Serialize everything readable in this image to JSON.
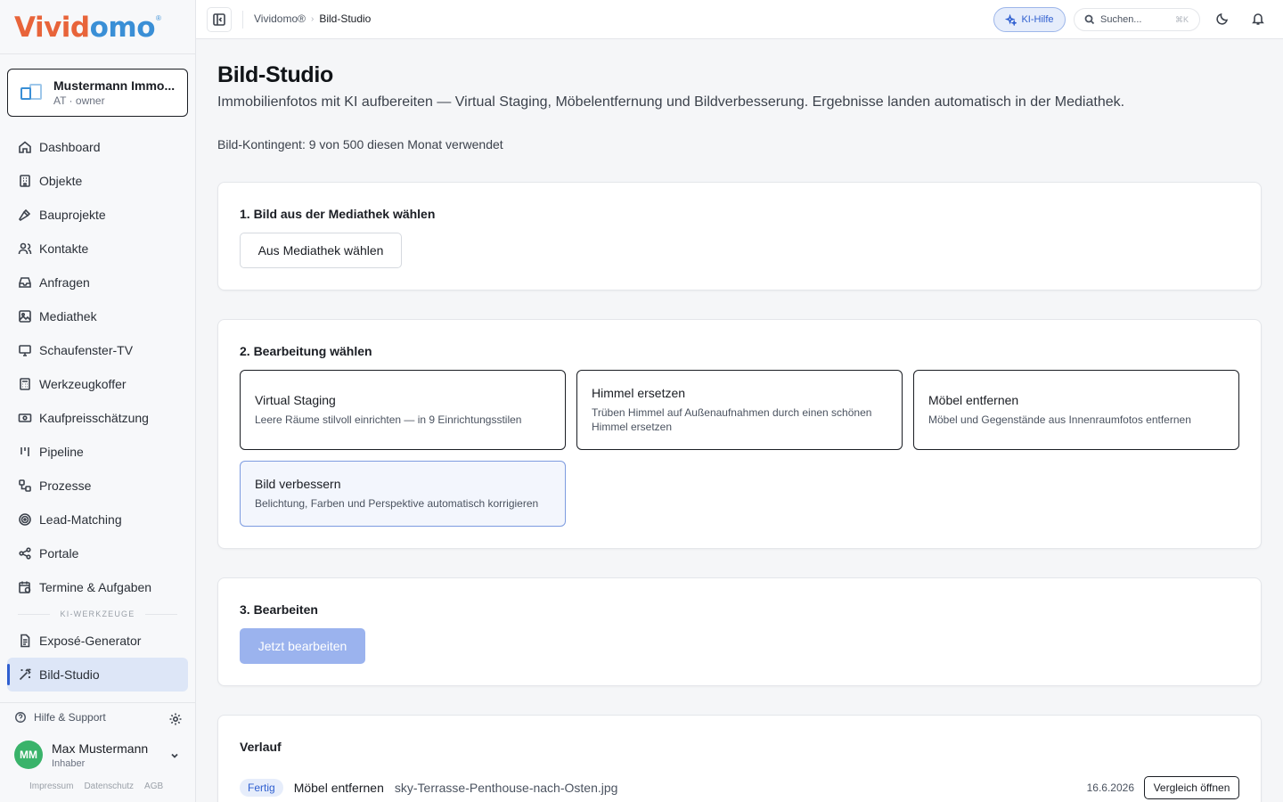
{
  "brand": {
    "logo_a": "Vivid",
    "logo_b": "omo",
    "reg": "®"
  },
  "org": {
    "name": "Mustermann Immo...",
    "sub": "AT · owner"
  },
  "nav": {
    "items": [
      {
        "label": "Dashboard",
        "icon": "home-icon"
      },
      {
        "label": "Objekte",
        "icon": "building-icon"
      },
      {
        "label": "Bauprojekte",
        "icon": "hammer-icon"
      },
      {
        "label": "Kontakte",
        "icon": "users-icon"
      },
      {
        "label": "Anfragen",
        "icon": "inbox-icon"
      },
      {
        "label": "Mediathek",
        "icon": "image-icon"
      },
      {
        "label": "Schaufenster-TV",
        "icon": "monitor-icon"
      },
      {
        "label": "Werkzeugkoffer",
        "icon": "calculator-icon"
      },
      {
        "label": "Kaufpreisschätzung",
        "icon": "banknote-icon"
      },
      {
        "label": "Pipeline",
        "icon": "kanban-icon"
      },
      {
        "label": "Prozesse",
        "icon": "workflow-icon"
      },
      {
        "label": "Lead-Matching",
        "icon": "target-icon"
      },
      {
        "label": "Portale",
        "icon": "share-icon"
      },
      {
        "label": "Termine & Aufgaben",
        "icon": "calendar-clock-icon"
      }
    ],
    "section_label": "KI-WERKZEUGE",
    "ai_items": [
      {
        "label": "Exposé-Generator",
        "icon": "file-text-icon"
      },
      {
        "label": "Bild-Studio",
        "icon": "wand-icon",
        "active": true
      }
    ]
  },
  "sidebar_footer": {
    "help": "Hilfe & Support",
    "user_initials": "MM",
    "user_name": "Max Mustermann",
    "user_role": "Inhaber",
    "legal": [
      "Impressum",
      "Datenschutz",
      "AGB"
    ]
  },
  "topbar": {
    "breadcrumb_root": "Vividomo®",
    "breadcrumb_current": "Bild-Studio",
    "ki_label": "KI-Hilfe",
    "search_placeholder": "Suchen...",
    "search_shortcut": "⌘K"
  },
  "page": {
    "title": "Bild-Studio",
    "description": "Immobilienfotos mit KI aufbereiten — Virtual Staging, Möbelentfernung und Bildverbesserung. Ergebnisse landen automatisch in der Mediathek.",
    "quota": "Bild-Kontingent: 9 von 500 diesen Monat verwendet"
  },
  "step1": {
    "title": "1. Bild aus der Mediathek wählen",
    "button": "Aus Mediathek wählen"
  },
  "step2": {
    "title": "2. Bearbeitung wählen",
    "options": [
      {
        "title": "Virtual Staging",
        "desc": "Leere Räume stilvoll einrichten — in 9 Einrichtungsstilen"
      },
      {
        "title": "Himmel ersetzen",
        "desc": "Trüben Himmel auf Außenaufnahmen durch einen schönen Himmel ersetzen"
      },
      {
        "title": "Möbel entfernen",
        "desc": "Möbel und Gegenstände aus Innenraumfotos entfernen"
      },
      {
        "title": "Bild verbessern",
        "desc": "Belichtung, Farben und Perspektive automatisch korrigieren",
        "selected": true
      }
    ]
  },
  "step3": {
    "title": "3. Bearbeiten",
    "button": "Jetzt bearbeiten"
  },
  "history": {
    "title": "Verlauf",
    "rows": [
      {
        "status": "Fertig",
        "type": "Möbel entfernen",
        "file": "sky-Terrasse-Penthouse-nach-Osten.jpg",
        "date": "16.6.2026",
        "action": "Vergleich öffnen"
      }
    ]
  },
  "colors": {
    "accent": "#2f5fd0",
    "brand_orange": "#e8643a",
    "brand_blue": "#3a8fd6",
    "avatar": "#39b36a"
  }
}
